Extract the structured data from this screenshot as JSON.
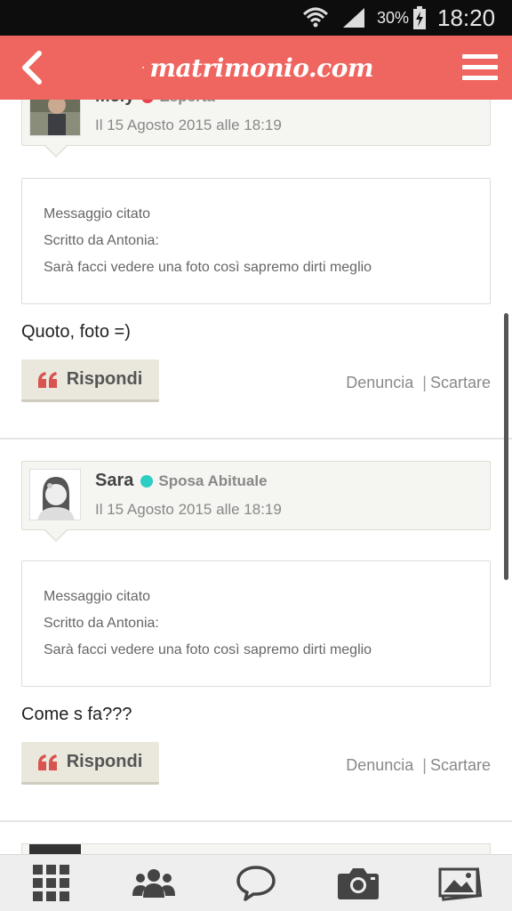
{
  "status_bar": {
    "battery": "30%",
    "time": "18:20",
    "icons": [
      "wifi-icon",
      "signal-icon",
      "battery-charging-icon"
    ]
  },
  "app_bar": {
    "logo_text": "matrimonio.com",
    "background": "#ef6560",
    "icons": [
      "back-arrow-icon",
      "heart-logo-icon",
      "hamburger-menu-icon"
    ]
  },
  "posts": [
    {
      "author": "Mely",
      "role": "Esperta",
      "role_dot_color": "#e8414f",
      "date": "Il 15 Agosto 2015 alle 18:19",
      "quote": {
        "label": "Messaggio citato",
        "written_by": "Scritto da Antonia:",
        "text": "Sarà facci vedere una foto così sapremo dirti meglio"
      },
      "message": "Quoto, foto =)",
      "reply_label": "Rispondi",
      "report_label": "Denuncia",
      "discard_label": "Scartare"
    },
    {
      "author": "Sara",
      "role": "Sposa Abituale",
      "role_dot_color": "#2ecdc4",
      "date": "Il 15 Agosto 2015 alle 18:19",
      "quote": {
        "label": "Messaggio citato",
        "written_by": "Scritto da Antonia:",
        "text": "Sarà facci vedere una foto così sapremo dirti meglio"
      },
      "message": "Come s fa???",
      "reply_label": "Rispondi",
      "report_label": "Denuncia",
      "discard_label": "Scartare"
    }
  ],
  "bottom_nav": {
    "icons": [
      "grid-icon",
      "community-icon",
      "chat-bubble-icon",
      "camera-icon",
      "photos-icon"
    ]
  },
  "colors": {
    "accent": "#ef6560",
    "reply_icon": "#d9534f",
    "card_bg": "#f5f6f1"
  }
}
